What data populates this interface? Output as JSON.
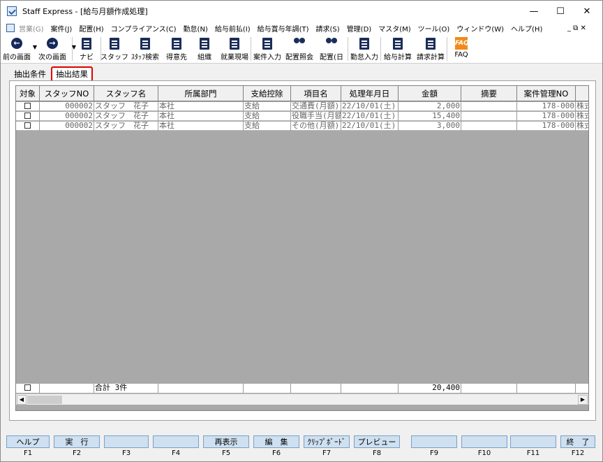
{
  "window": {
    "title": "Staff Express - [給与月額作成処理]",
    "controls": {
      "minimize": "—",
      "maximize": "☐",
      "close": "✕"
    }
  },
  "menu": {
    "items": [
      {
        "label": "営業(G)",
        "disabled": true
      },
      {
        "label": "案件(J)"
      },
      {
        "label": "配置(H)"
      },
      {
        "label": "コンプライアンス(C)"
      },
      {
        "label": "勤怠(N)"
      },
      {
        "label": "給与前払(I)"
      },
      {
        "label": "給与賞与年調(T)"
      },
      {
        "label": "請求(S)"
      },
      {
        "label": "管理(D)"
      },
      {
        "label": "マスタ(M)"
      },
      {
        "label": "ツール(O)"
      },
      {
        "label": "ウィンドウ(W)"
      },
      {
        "label": "ヘルプ(H)"
      }
    ],
    "mdi_controls": "_  ⧉  ✕"
  },
  "toolbar": {
    "items": [
      {
        "label": "前の画面",
        "icon": "arrow-left-icon"
      },
      {
        "label": "次の画面",
        "icon": "arrow-right-icon"
      },
      {
        "label": "ナビ",
        "icon": "navi-icon"
      },
      {
        "label": "スタッフ",
        "icon": "staff-icon"
      },
      {
        "label": "ｽﾀｯﾌ検索",
        "icon": "staff-search-icon"
      },
      {
        "label": "得意先",
        "icon": "customer-icon"
      },
      {
        "label": "組織",
        "icon": "organization-icon"
      },
      {
        "label": "就業現場",
        "icon": "worksite-icon"
      },
      {
        "label": "案件入力",
        "icon": "case-entry-icon"
      },
      {
        "label": "配置照会",
        "icon": "placement-inquiry-icon"
      },
      {
        "label": "配置(日",
        "icon": "placement-day-icon"
      },
      {
        "label": "勤怠入力",
        "icon": "attendance-entry-icon"
      },
      {
        "label": "給与計算",
        "icon": "payroll-calc-icon"
      },
      {
        "label": "請求計算",
        "icon": "billing-calc-icon"
      },
      {
        "label": "FAQ",
        "icon": "faq-icon"
      }
    ]
  },
  "tabs": [
    {
      "label": "抽出条件",
      "active": false
    },
    {
      "label": "抽出結果",
      "active": true
    }
  ],
  "grid": {
    "columns": [
      "対象",
      "スタッフNO",
      "スタッフ名",
      "所属部門",
      "支給控除",
      "項目名",
      "処理年月日",
      "金額",
      "摘要",
      "案件管理NO",
      ""
    ],
    "rows": [
      [
        "",
        "000002",
        "スタッフ　花子",
        "本社",
        "支給",
        "交通費(月額)",
        "22/10/01(土)",
        "2,000",
        "",
        "178-000",
        "株式"
      ],
      [
        "",
        "000002",
        "スタッフ　花子",
        "本社",
        "支給",
        "役職手当(月額)",
        "22/10/01(土)",
        "15,400",
        "",
        "178-000",
        "株式"
      ],
      [
        "",
        "000002",
        "スタッフ　花子",
        "本社",
        "支給",
        "その他(月額)",
        "22/10/01(土)",
        "3,000",
        "",
        "178-000",
        "株式"
      ]
    ],
    "footer": {
      "count_label": "合計 3件",
      "total_amount": "20,400"
    }
  },
  "fkeys": [
    {
      "label": "ヘルプ",
      "key": "F1"
    },
    {
      "label": "実　行",
      "key": "F2"
    },
    {
      "label": "",
      "key": "F3"
    },
    {
      "label": "",
      "key": "F4"
    },
    {
      "label": "再表示",
      "key": "F5"
    },
    {
      "label": "編　集",
      "key": "F6"
    },
    {
      "label": "ｸﾘｯﾌﾟﾎﾞｰﾄﾞ",
      "key": "F7"
    },
    {
      "label": "プレビュー",
      "key": "F8"
    },
    {
      "label": "",
      "key": "F9"
    },
    {
      "label": "",
      "key": "F10"
    },
    {
      "label": "",
      "key": "F11"
    },
    {
      "label": "終　了",
      "key": "F12"
    }
  ]
}
